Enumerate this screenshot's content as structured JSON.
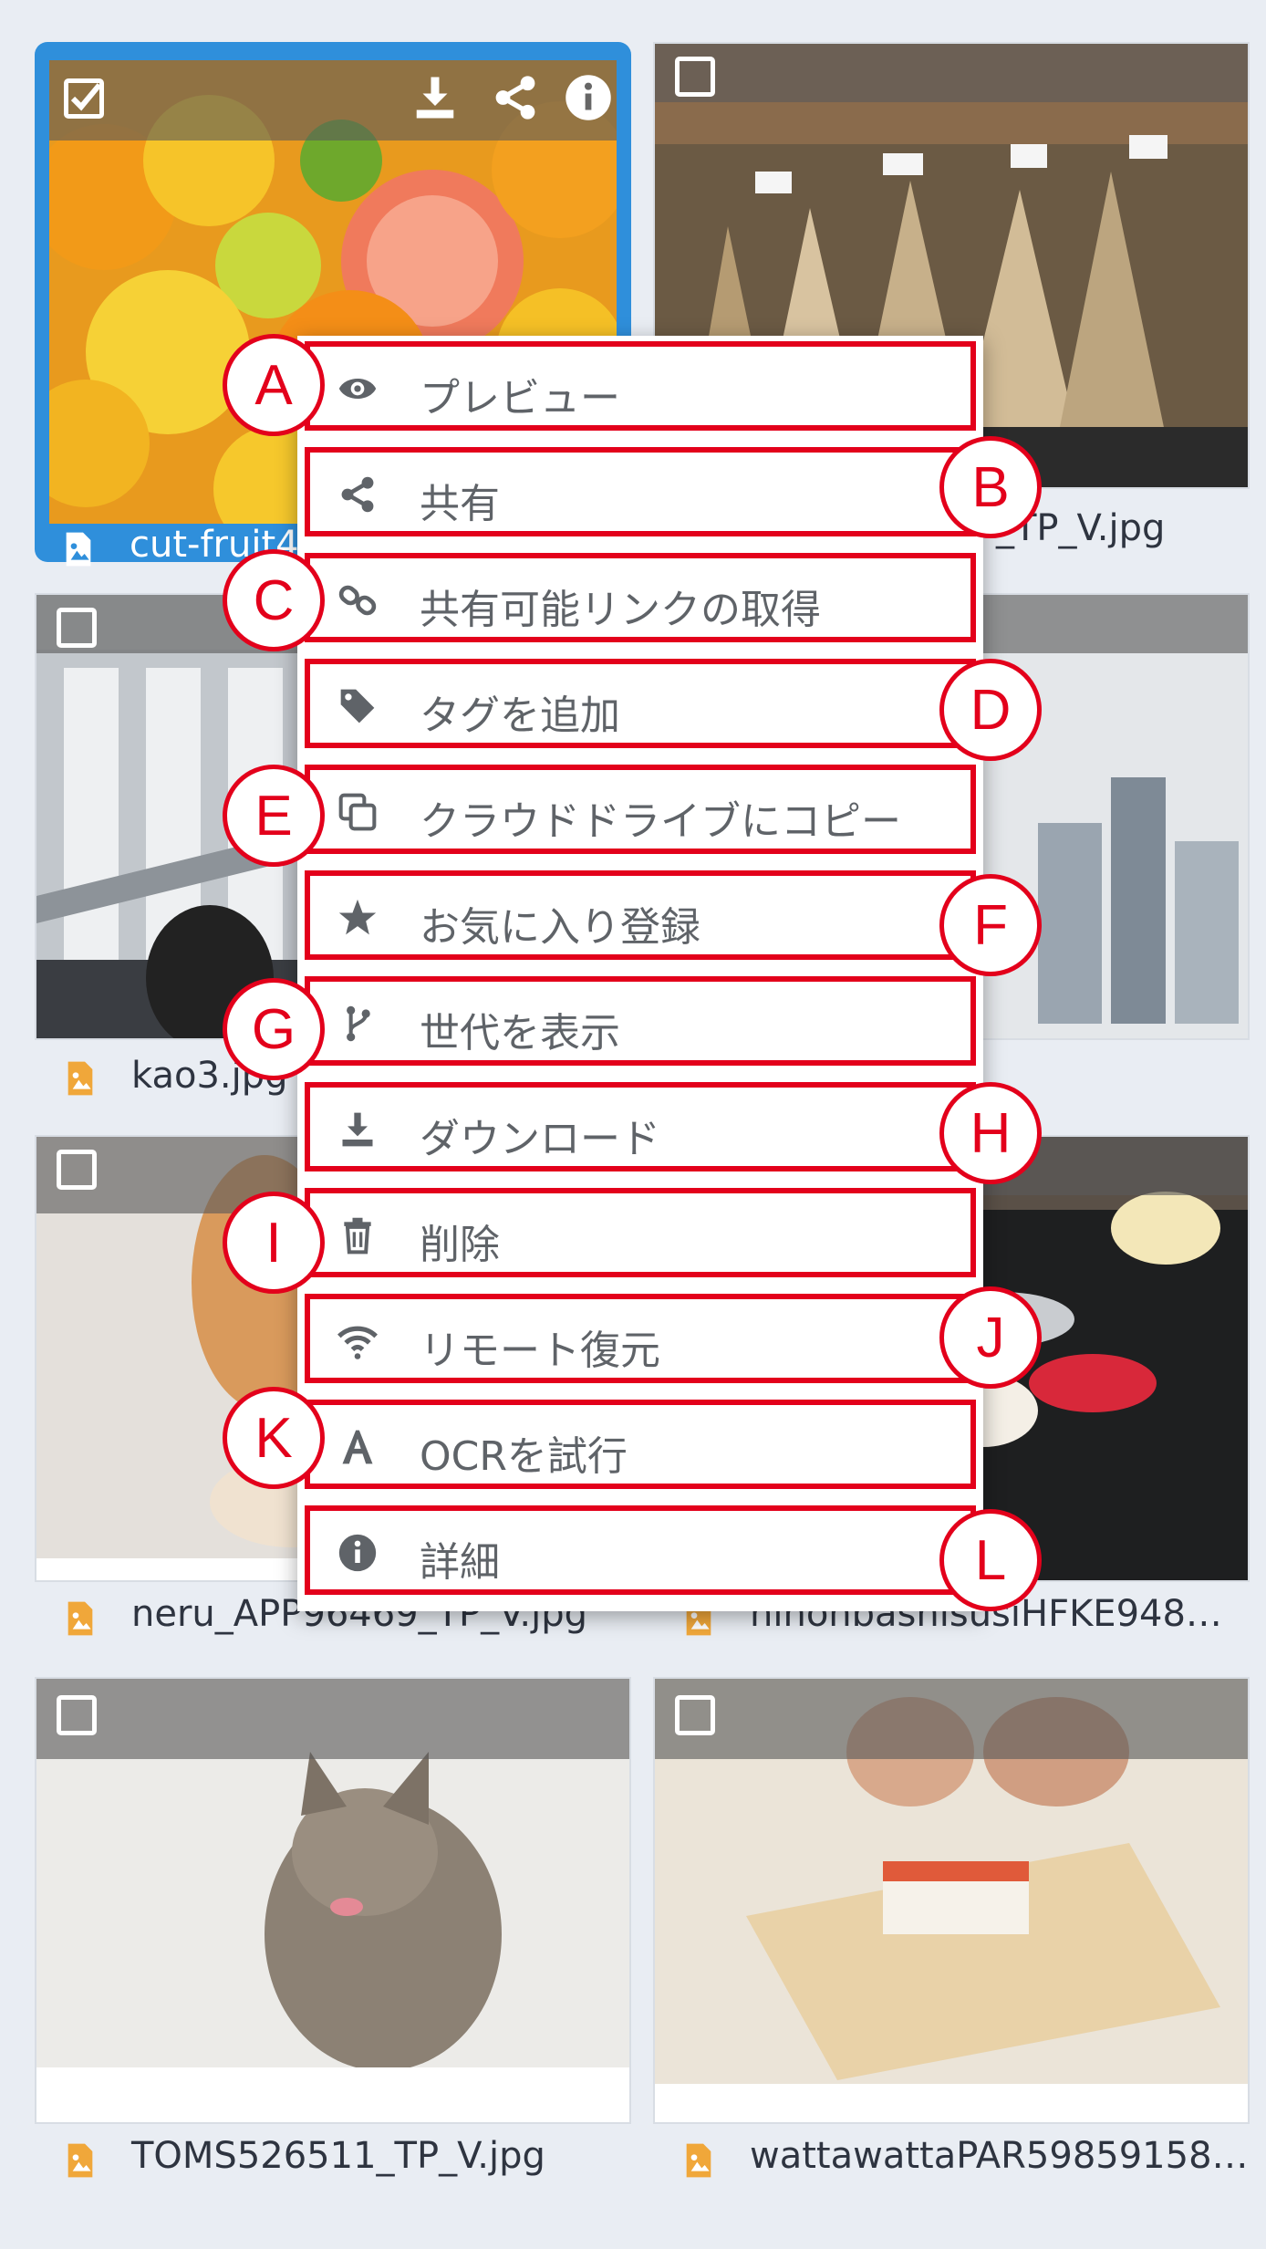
{
  "tiles": [
    {
      "name": "cut-fruit4",
      "selected": true,
      "icon": "image-file-icon"
    },
    {
      "name": "_TP_V.jpg",
      "selected": false,
      "icon": "image-file-icon"
    },
    {
      "name": "kao3.jpg",
      "selected": false,
      "icon": "image-file-icon"
    },
    {
      "name": "",
      "selected": false,
      "icon": "image-file-icon"
    },
    {
      "name": "neru_APP96469_TP_V.jpg",
      "selected": false,
      "icon": "image-file-icon"
    },
    {
      "name": "nihonbashisusiHFKE948…",
      "selected": false,
      "icon": "image-file-icon"
    },
    {
      "name": "TOMS526511_TP_V.jpg",
      "selected": false,
      "icon": "image-file-icon"
    },
    {
      "name": "wattawattaPAR59859158…",
      "selected": false,
      "icon": "image-file-icon"
    }
  ],
  "selected_tile_actions": [
    "download-icon",
    "share-icon",
    "info-icon"
  ],
  "context_menu": {
    "items": [
      {
        "badge": "A",
        "label": "プレビュー",
        "icon": "eye-icon"
      },
      {
        "badge": "B",
        "label": "共有",
        "icon": "share-icon"
      },
      {
        "badge": "C",
        "label": "共有可能リンクの取得",
        "icon": "link-icon"
      },
      {
        "badge": "D",
        "label": "タグを追加",
        "icon": "tag-icon"
      },
      {
        "badge": "E",
        "label": "クラウドドライブにコピー",
        "icon": "copy-icon"
      },
      {
        "badge": "F",
        "label": "お気に入り登録",
        "icon": "star-icon"
      },
      {
        "badge": "G",
        "label": "世代を表示",
        "icon": "branch-icon"
      },
      {
        "badge": "H",
        "label": "ダウンロード",
        "icon": "download-icon"
      },
      {
        "badge": "I",
        "label": "削除",
        "icon": "trash-icon"
      },
      {
        "badge": "J",
        "label": "リモート復元",
        "icon": "wifi-icon"
      },
      {
        "badge": "K",
        "label": "OCRを試行",
        "icon": "ocr-icon"
      },
      {
        "badge": "L",
        "label": "詳細",
        "icon": "info-icon"
      }
    ]
  },
  "colors": {
    "selection": "#2f8fdb",
    "annotation": "#e3001b",
    "file_icon": "#f0a73a",
    "menu_text": "#5f6368"
  }
}
